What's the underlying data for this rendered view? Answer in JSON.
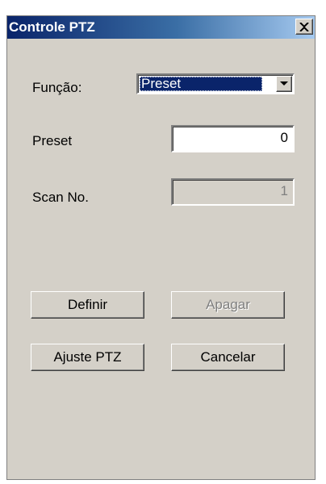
{
  "window": {
    "title": "Controle PTZ",
    "close_glyph": "×",
    "close_icon": "close-icon"
  },
  "form": {
    "funcao_label": "Função:",
    "funcao_value": "Preset",
    "funcao_arrow_icon": "chevron-down-icon",
    "preset_label": "Preset",
    "preset_value": "0",
    "scan_label": "Scan No.",
    "scan_value": "1"
  },
  "buttons": {
    "definir": "Definir",
    "apagar": "Apagar",
    "ajuste": "Ajuste PTZ",
    "cancelar": "Cancelar"
  },
  "colors": {
    "titlebar_start": "#0a246a",
    "titlebar_end": "#a6caf0",
    "dialog_bg": "#d4d0c8",
    "selection": "#0a246a"
  }
}
